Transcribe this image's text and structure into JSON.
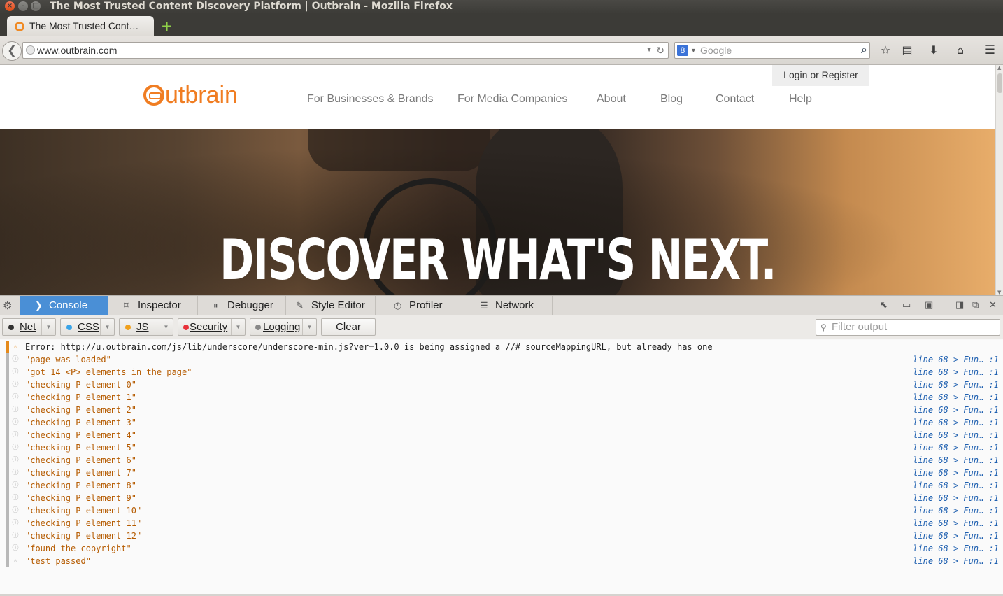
{
  "window": {
    "title": "The Most Trusted Content Discovery Platform | Outbrain - Mozilla Firefox",
    "close": "×",
    "minimize": "–",
    "maximize": "□"
  },
  "tabs": [
    {
      "label": "The Most Trusted Cont…"
    }
  ],
  "newtab_icon": "+",
  "navbar": {
    "back_icon": "back-arrow-icon",
    "url": "www.outbrain.com",
    "search_engine": "8",
    "search_placeholder": "Google",
    "toolbar_icons": [
      "star-icon",
      "reading-list-icon",
      "download-icon",
      "home-icon",
      "menu-icon"
    ]
  },
  "site": {
    "logo": "utbrain",
    "login": "Login",
    "or": "or",
    "register": "Register",
    "nav": [
      "For Businesses & Brands",
      "For Media Companies",
      "About",
      "Blog",
      "Contact",
      "Help"
    ],
    "hero_text": "DISCOVER WHAT'S NEXT."
  },
  "devtools": {
    "tabs": [
      {
        "label": "Console",
        "icon": "console-icon",
        "active": true
      },
      {
        "label": "Inspector",
        "icon": "inspector-icon",
        "active": false
      },
      {
        "label": "Debugger",
        "icon": "debugger-icon",
        "active": false
      },
      {
        "label": "Style Editor",
        "icon": "style-editor-icon",
        "active": false
      },
      {
        "label": "Profiler",
        "icon": "profiler-icon",
        "active": false
      },
      {
        "label": "Network",
        "icon": "network-icon",
        "active": false
      }
    ],
    "filters": [
      {
        "label": "Net",
        "color": "#333333"
      },
      {
        "label": "CSS",
        "color": "#3aa4e8"
      },
      {
        "label": "JS",
        "color": "#f0a01c"
      },
      {
        "label": "Security",
        "color": "#e8313a"
      },
      {
        "label": "Logging",
        "color": "#888888"
      }
    ],
    "clear": "Clear",
    "filter_placeholder": "Filter output",
    "messages": [
      {
        "type": "error",
        "text": "Error: http://u.outbrain.com/js/lib/underscore/underscore-min.js?ver=1.0.0 is being assigned a //# sourceMappingURL, but already has one",
        "loc": ""
      },
      {
        "type": "log",
        "text": "\"page was loaded\"",
        "loc": "line 68 > Fun… :1"
      },
      {
        "type": "log",
        "text": "\"got 14 <P> elements in the page\"",
        "loc": "line 68 > Fun… :1"
      },
      {
        "type": "log",
        "text": "\"checking P element 0\"",
        "loc": "line 68 > Fun… :1"
      },
      {
        "type": "log",
        "text": "\"checking P element 1\"",
        "loc": "line 68 > Fun… :1"
      },
      {
        "type": "log",
        "text": "\"checking P element 2\"",
        "loc": "line 68 > Fun… :1"
      },
      {
        "type": "log",
        "text": "\"checking P element 3\"",
        "loc": "line 68 > Fun… :1"
      },
      {
        "type": "log",
        "text": "\"checking P element 4\"",
        "loc": "line 68 > Fun… :1"
      },
      {
        "type": "log",
        "text": "\"checking P element 5\"",
        "loc": "line 68 > Fun… :1"
      },
      {
        "type": "log",
        "text": "\"checking P element 6\"",
        "loc": "line 68 > Fun… :1"
      },
      {
        "type": "log",
        "text": "\"checking P element 7\"",
        "loc": "line 68 > Fun… :1"
      },
      {
        "type": "log",
        "text": "\"checking P element 8\"",
        "loc": "line 68 > Fun… :1"
      },
      {
        "type": "log",
        "text": "\"checking P element 9\"",
        "loc": "line 68 > Fun… :1"
      },
      {
        "type": "log",
        "text": "\"checking P element 10\"",
        "loc": "line 68 > Fun… :1"
      },
      {
        "type": "log",
        "text": "\"checking P element 11\"",
        "loc": "line 68 > Fun… :1"
      },
      {
        "type": "log",
        "text": "\"checking P element 12\"",
        "loc": "line 68 > Fun… :1"
      },
      {
        "type": "log",
        "text": "\"found the copyright\"",
        "loc": "line 68 > Fun… :1"
      },
      {
        "type": "warn",
        "text": "\"test passed\"",
        "loc": "line 68 > Fun… :1"
      }
    ]
  }
}
